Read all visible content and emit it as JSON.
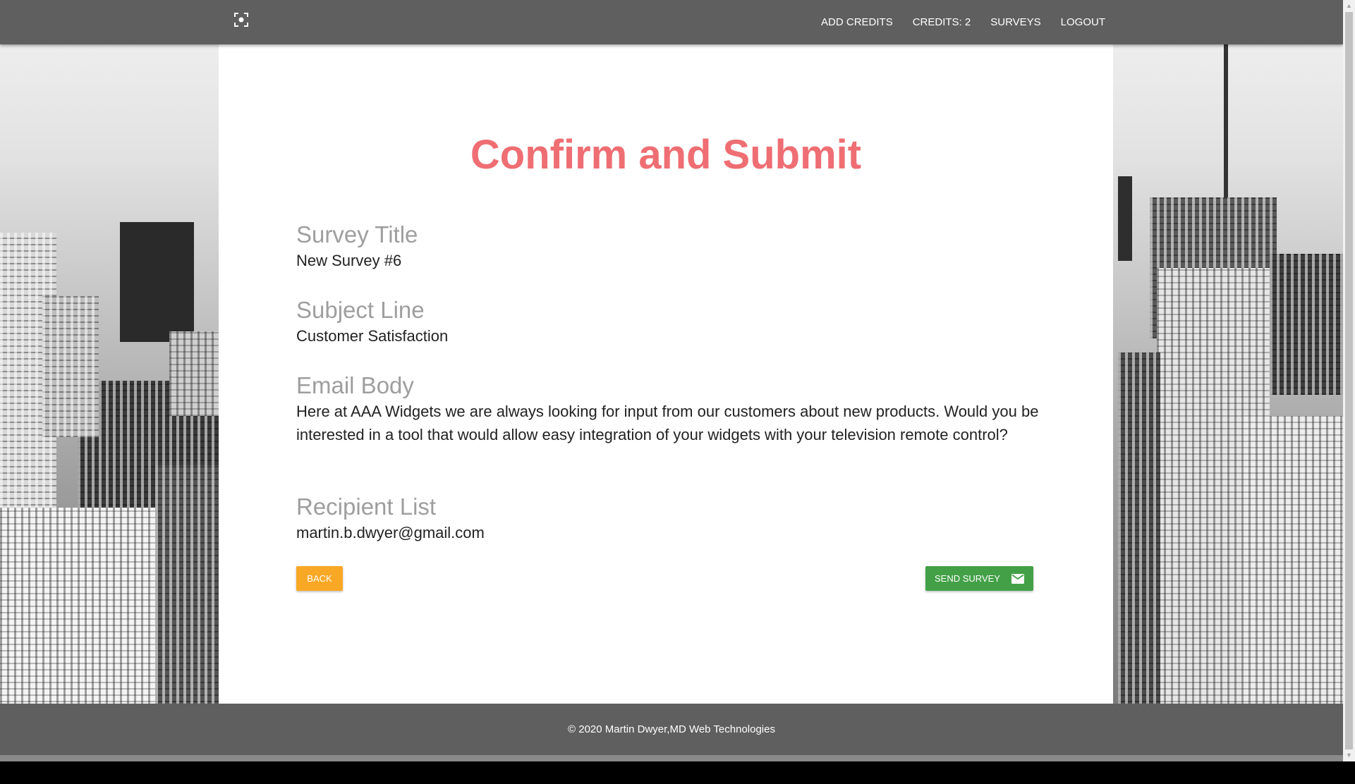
{
  "navbar": {
    "brand_icon": "focus-scan-icon",
    "links": [
      {
        "label": "ADD CREDITS"
      },
      {
        "label": "CREDITS: 2"
      },
      {
        "label": "SURVEYS"
      },
      {
        "label": "LOGOUT"
      }
    ]
  },
  "main": {
    "title": "Confirm and Submit",
    "fields": [
      {
        "label": "Survey Title",
        "value": "New Survey #6"
      },
      {
        "label": "Subject Line",
        "value": "Customer Satisfaction"
      },
      {
        "label": "Email Body",
        "value": "Here at AAA Widgets we are always looking for input from our customers about new products. Would you be interested in a tool that would allow easy integration of your widgets with your television remote control?"
      },
      {
        "label": "Recipient List",
        "value": "martin.b.dwyer@gmail.com"
      }
    ],
    "back_label": "BACK",
    "send_label": "SEND SURVEY",
    "send_icon": "email-icon"
  },
  "footer": {
    "text": "© 2020 Martin Dwyer,MD Web Technologies"
  },
  "colors": {
    "navbar": "#5f5f5f",
    "title": "#ee6e73",
    "back_button": "#f9a825",
    "send_button": "#43a047",
    "label": "#9e9e9e"
  }
}
